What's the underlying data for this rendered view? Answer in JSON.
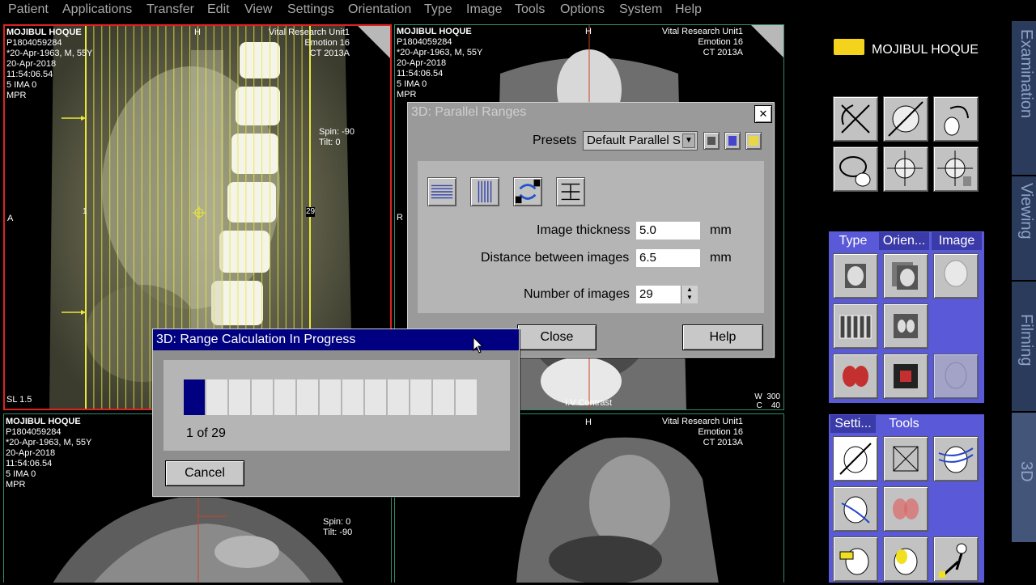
{
  "menu": [
    "Patient",
    "Applications",
    "Transfer",
    "Edit",
    "View",
    "Settings",
    "Orientation",
    "Type",
    "Image",
    "Tools",
    "Options",
    "System",
    "Help"
  ],
  "viewport_tl": {
    "patient": "MOJIBUL HOQUE",
    "id": "P1804059284",
    "dob": "*20-Apr-1963, M, 55Y",
    "date": "20-Apr-2018",
    "time": "11:54:06.54",
    "ima": "5 IMA 0",
    "mode": "MPR",
    "top_marker": "H",
    "left_marker": "A",
    "hospital": "Vital Research Unit1",
    "scanner": "Emotion 16",
    "ct": "CT 2013A",
    "spin": "Spin: -90",
    "tilt": "Tilt:  0",
    "slice_first": "1",
    "slice_last": "29",
    "sl": "SL 1.5"
  },
  "viewport_tr": {
    "patient": "MOJIBUL HOQUE",
    "id": "P1804059284",
    "dob": "*20-Apr-1963, M, 55Y",
    "date": "20-Apr-2018",
    "time": "11:54:06.54",
    "ima": "5 IMA 0",
    "mode": "MPR",
    "top_marker": "H",
    "left_marker": "R",
    "hospital": "Vital Research Unit1",
    "scanner": "Emotion 16",
    "ct": "CT 2013A",
    "contrast": "I.V Contrast",
    "w": "W",
    "w_val": "300",
    "c": "C",
    "c_val": "40"
  },
  "viewport_bl": {
    "patient": "MOJIBUL HOQUE",
    "id": "P1804059284",
    "dob": "*20-Apr-1963, M, 55Y",
    "date": "20-Apr-2018",
    "time": "11:54:06.54",
    "ima": "5 IMA 0",
    "mode": "MPR",
    "spin": "Spin:  0",
    "tilt": "Tilt: -90"
  },
  "viewport_br": {
    "top_marker": "H",
    "hospital": "Vital Research Unit1",
    "scanner": "Emotion 16",
    "ct": "CT 2013A"
  },
  "parallel_dialog": {
    "title": "3D: Parallel Ranges",
    "presets_label": "Presets",
    "presets_value": "Default Parallel S",
    "thickness_label": "Image thickness",
    "thickness_value": "5.0",
    "thickness_unit": "mm",
    "distance_label": "Distance between images",
    "distance_value": "6.5",
    "distance_unit": "mm",
    "number_label": "Number of images",
    "number_value": "29",
    "close_label": "Close",
    "help_label": "Help",
    "close_x": "✕"
  },
  "progress_dialog": {
    "title": "3D: Range Calculation In Progress",
    "progress_text": "1 of 29",
    "progress_fraction": 0.0345,
    "segments": 13,
    "cancel_label": "Cancel"
  },
  "right_panel": {
    "patient_name": "MOJIBUL HOQUE",
    "type_tab": "Type",
    "orien_tab": "Orien...",
    "image_tab": "Image",
    "setti_tab": "Setti...",
    "tools_tab": "Tools",
    "side_tabs": [
      "Examination",
      "Viewing",
      "Filming",
      "3D"
    ]
  },
  "colors": {
    "active_border": "#d22",
    "viewport_border": "#2e8a6a",
    "titlebar": "#000080",
    "panel_blue": "#5a5ad8"
  }
}
